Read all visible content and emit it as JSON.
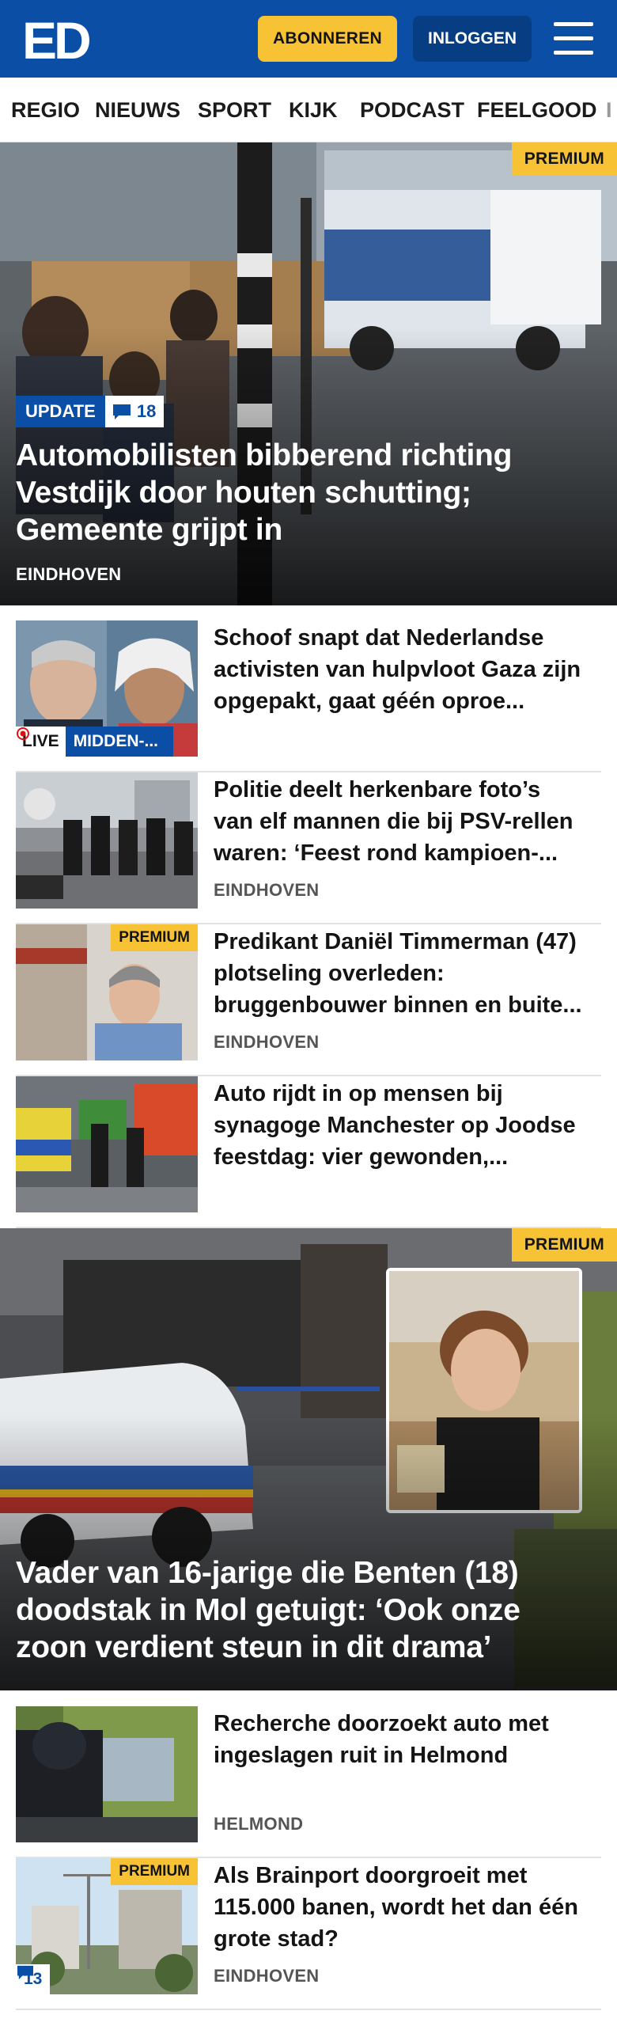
{
  "header": {
    "logo_text": "ED",
    "subscribe_label": "ABONNEREN",
    "login_label": "INLOGGEN",
    "brand_color": "#0a4fa5",
    "accent_color": "#f7c233"
  },
  "nav": {
    "items": [
      "REGIO",
      "NIEUWS",
      "SPORT",
      "KIJK",
      "PODCAST",
      "FEELGOOD",
      "I"
    ]
  },
  "hero": {
    "premium_label": "PREMIUM",
    "update_label": "UPDATE",
    "comment_count": "18",
    "title": "Automobilisten bibberend richting Vestdijk door houten schutting; Gemeente grijpt in",
    "location": "EINDHOVEN"
  },
  "articles": [
    {
      "title": "Schoof snapt dat Nederlandse activisten van hulpvloot Gaza zijn opgepakt, gaat géén oproe...",
      "live_label": "LIVE",
      "section_label": "MIDDEN-...",
      "location": ""
    },
    {
      "title": "Politie deelt herkenbare foto’s van elf mannen die bij PSV-rellen waren: ‘Feest rond kampioen-...",
      "location": "EINDHOVEN"
    },
    {
      "title": "Predikant Daniël Timmerman (47) plotseling overleden: bruggenbouwer binnen en buite...",
      "premium_label": "PREMIUM",
      "location": "EINDHOVEN"
    },
    {
      "title": "Auto rijdt in op mensen bij synagoge Manchester op Joodse feestdag: vier gewonden,...",
      "location": ""
    }
  ],
  "hero2": {
    "premium_label": "PREMIUM",
    "title": "Vader van 16-jarige die Benten (18) doodstak in Mol getuigt: ‘Ook onze zoon verdient steun in dit drama’"
  },
  "articles2": [
    {
      "title": "Recherche doorzoekt auto met ingeslagen ruit in Helmond",
      "location": "HELMOND"
    },
    {
      "title": "Als Brainport doorgroeit met 115.000 banen, wordt het dan één grote stad?",
      "premium_label": "PREMIUM",
      "comment_count": "13",
      "location": "EINDHOVEN"
    }
  ]
}
